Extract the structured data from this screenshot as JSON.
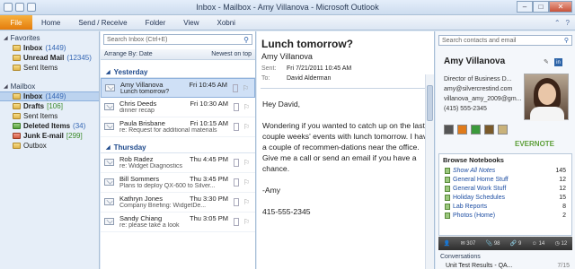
{
  "window": {
    "title": "Inbox - Mailbox - Amy Villanova - Microsoft Outlook"
  },
  "ribbon": {
    "file": "File",
    "tabs": [
      "Home",
      "Send / Receive",
      "Folder",
      "View",
      "Xobni"
    ]
  },
  "nav": {
    "favorites_header": "Favorites",
    "favorites": [
      {
        "label": "Inbox",
        "count": "(1449)",
        "bold": true
      },
      {
        "label": "Unread Mail",
        "count": "(12345)",
        "bold": true
      },
      {
        "label": "Sent Items",
        "count": "",
        "bold": false
      }
    ],
    "mailbox_header": "Mailbox",
    "mailbox": [
      {
        "label": "Inbox",
        "count": "(1449)",
        "bold": true,
        "selected": true
      },
      {
        "label": "Drafts",
        "count": "[106]",
        "bold": true
      },
      {
        "label": "Sent Items",
        "count": "",
        "bold": false
      },
      {
        "label": "Deleted Items",
        "count": "(34)",
        "bold": true
      },
      {
        "label": "Junk E-mail",
        "count": "[299]",
        "bold": true
      },
      {
        "label": "Outbox",
        "count": "",
        "bold": false
      }
    ]
  },
  "list": {
    "search_placeholder": "Search Inbox (Ctrl+E)",
    "arrange_by": "Arrange By: Date",
    "sort": "Newest on top",
    "groups": [
      {
        "name": "Yesterday",
        "messages": [
          {
            "from": "Amy Villanova",
            "time": "Fri 10:45 AM",
            "subject": "Lunch tomorrow?",
            "selected": true
          },
          {
            "from": "Chris Deeds",
            "time": "Fri 10:30 AM",
            "subject": "dinner recap"
          },
          {
            "from": "Paula Brisbane",
            "time": "Fri 10:15 AM",
            "subject": "re: Request for additional materials"
          }
        ]
      },
      {
        "name": "Thursday",
        "messages": [
          {
            "from": "Rob Radez",
            "time": "Thu 4:45 PM",
            "subject": "re: Widget Diagnostics"
          },
          {
            "from": "Bill Sommers",
            "time": "Thu 3:45 PM",
            "subject": "Plans to deploy QX-600 to Silver..."
          },
          {
            "from": "Kathryn Jones",
            "time": "Thu 3:30 PM",
            "subject": "Company Briefing: WidgetDe..."
          },
          {
            "from": "Sandy Chiang",
            "time": "Thu 3:05 PM",
            "subject": "re: please take a look"
          }
        ]
      }
    ]
  },
  "reading": {
    "subject": "Lunch tomorrow?",
    "from": "Amy Villanova",
    "sent_label": "Sent:",
    "sent": "Fri 7/21/2011 10:45 AM",
    "to_label": "To:",
    "to": "David Alderman",
    "body": [
      "Hey David,",
      "Wondering if you wanted to catch up on the last couple weeks' events with lunch tomorrow. I have a couple of recommen-dations near the office. Give me a call or send an email if you have a chance.",
      "-Amy",
      "415-555-2345"
    ]
  },
  "people": {
    "search_placeholder": "Search contacts and email",
    "name": "Amy Villanova",
    "title": "Director of Business D...",
    "email1": "amy@silvercrestind.com",
    "email2": "villanova_amy_2009@gm...",
    "phone": "(415) 555-2345",
    "evernote": "EVERNOTE",
    "notebooks_header": "Browse Notebooks",
    "notebooks": [
      {
        "label": "Show All Notes",
        "count": "145"
      },
      {
        "label": "General Home Stuff",
        "count": "12"
      },
      {
        "label": "General Work Stuff",
        "count": "12"
      },
      {
        "label": "Holiday Schedules",
        "count": "15"
      },
      {
        "label": "Lab Reports",
        "count": "8"
      },
      {
        "label": "Photos (Home)",
        "count": "2"
      }
    ],
    "bar_counts": [
      "307",
      "98",
      "9",
      "14",
      "12"
    ],
    "conversations_header": "Conversations",
    "conversation": {
      "label": "Unit Test Results - QA...",
      "date": "7/15"
    }
  }
}
